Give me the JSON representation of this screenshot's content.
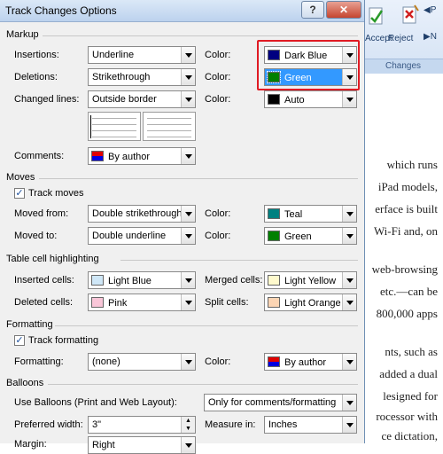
{
  "dialog": {
    "title": "Track Changes Options",
    "help_button": "?",
    "close_button": "✕"
  },
  "markup": {
    "section": "Markup",
    "insertions_label": "Insertions:",
    "insertions_value": "Underline",
    "deletions_label": "Deletions:",
    "deletions_value": "Strikethrough",
    "changed_lines_label": "Changed lines:",
    "changed_lines_value": "Outside border",
    "color_label": "Color:",
    "insertions_color": "Dark Blue",
    "deletions_color": "Green",
    "changed_lines_color": "Auto",
    "comments_label": "Comments:",
    "comments_value": "By author"
  },
  "moves": {
    "section": "Moves",
    "track_moves": "Track moves",
    "moved_from_label": "Moved from:",
    "moved_from_value": "Double strikethrough",
    "moved_from_color": "Teal",
    "moved_to_label": "Moved to:",
    "moved_to_value": "Double underline",
    "moved_to_color": "Green",
    "color_label": "Color:"
  },
  "table_cells": {
    "section": "Table cell highlighting",
    "inserted_label": "Inserted cells:",
    "inserted_value": "Light Blue",
    "merged_label": "Merged cells:",
    "merged_value": "Light Yellow",
    "deleted_label": "Deleted cells:",
    "deleted_value": "Pink",
    "split_label": "Split cells:",
    "split_value": "Light Orange"
  },
  "formatting": {
    "section": "Formatting",
    "track_formatting": "Track formatting",
    "formatting_label": "Formatting:",
    "formatting_value": "(none)",
    "color_label": "Color:",
    "color_value": "By author"
  },
  "balloons": {
    "section": "Balloons",
    "use_balloons_label": "Use Balloons (Print and Web Layout):",
    "use_balloons_value": "Only for comments/formatting",
    "preferred_width_label": "Preferred width:",
    "preferred_width_value": "3\"",
    "measure_in_label": "Measure in:",
    "measure_in_value": "Inches",
    "margin_label": "Margin:",
    "margin_value": "Right"
  },
  "colors": {
    "dark_blue": "#000080",
    "green": "#008000",
    "auto": "#000000",
    "teal": "#008080",
    "light_blue": "#cfe7f7",
    "pink": "#f9c6d8",
    "light_yellow": "#fffacd",
    "light_orange": "#fcd5b4",
    "by_author_top": "#e00000",
    "by_author_bottom": "#0000e0",
    "highlight": "#3399ff",
    "callout": "#e01b24"
  },
  "ribbon": {
    "accept": "Accept",
    "reject": "Reject",
    "group": "Changes"
  },
  "document_lines": [
    "which  runs",
    "iPad models,",
    "erface is built",
    "Wi-Fi and, on",
    "web-browsing",
    "etc.—can be",
    "800,000 apps",
    "nts,  such  as",
    "added a dual",
    "lesigned  for",
    "rocessor with",
    "ce dictation,"
  ]
}
